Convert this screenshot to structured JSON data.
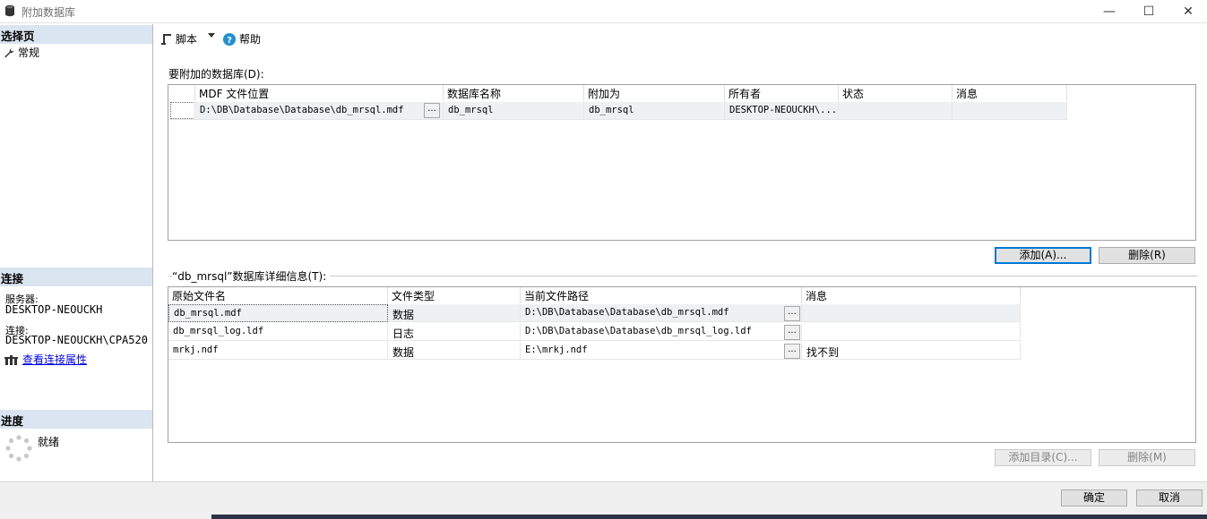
{
  "window": {
    "title": "附加数据库",
    "minimize": "—",
    "maximize": "☐",
    "close": "✕"
  },
  "left": {
    "select_page_header": "选择页",
    "pages": [
      {
        "label": "常规",
        "icon": "wrench-icon"
      }
    ],
    "connection_header": "连接",
    "server_label": "服务器:",
    "server_value": "DESKTOP-NEOUCKH",
    "connection_label": "连接:",
    "connection_value": "DESKTOP-NEOUCKH\\CPA520",
    "view_props_link": "查看连接属性",
    "progress_header": "进度",
    "progress_status": "就绪"
  },
  "toolbar": {
    "script_label": "脚本",
    "help_label": "帮助"
  },
  "attach": {
    "group_label": "要附加的数据库(D):",
    "columns": [
      "MDF 文件位置",
      "数据库名称",
      "附加为",
      "所有者",
      "状态",
      "消息"
    ],
    "rows": [
      {
        "mdf": "D:\\DB\\Database\\Database\\db_mrsql.mdf",
        "name": "db_mrsql",
        "attach_as": "db_mrsql",
        "owner": "DESKTOP-NEOUCKH\\...",
        "status": "",
        "message": ""
      }
    ],
    "browse": "...",
    "add_button": "添加(A)...",
    "remove_button": "删除(R)"
  },
  "details": {
    "group_label": "“db_mrsql”数据库详细信息(T):",
    "columns": [
      "原始文件名",
      "文件类型",
      "当前文件路径",
      "消息"
    ],
    "rows": [
      {
        "file": "db_mrsql.mdf",
        "type": "数据",
        "path": "D:\\DB\\Database\\Database\\db_mrsql.mdf",
        "message": ""
      },
      {
        "file": "db_mrsql_log.ldf",
        "type": "日志",
        "path": "D:\\DB\\Database\\Database\\db_mrsql_log.ldf",
        "message": ""
      },
      {
        "file": "mrkj.ndf",
        "type": "数据",
        "path": "E:\\mrkj.ndf",
        "message": "找不到"
      }
    ],
    "browse": "...",
    "add_catalog_button": "添加目录(C)...",
    "remove_button": "删除(M)"
  },
  "footer": {
    "ok_button": "确定",
    "cancel_button": "取消"
  }
}
